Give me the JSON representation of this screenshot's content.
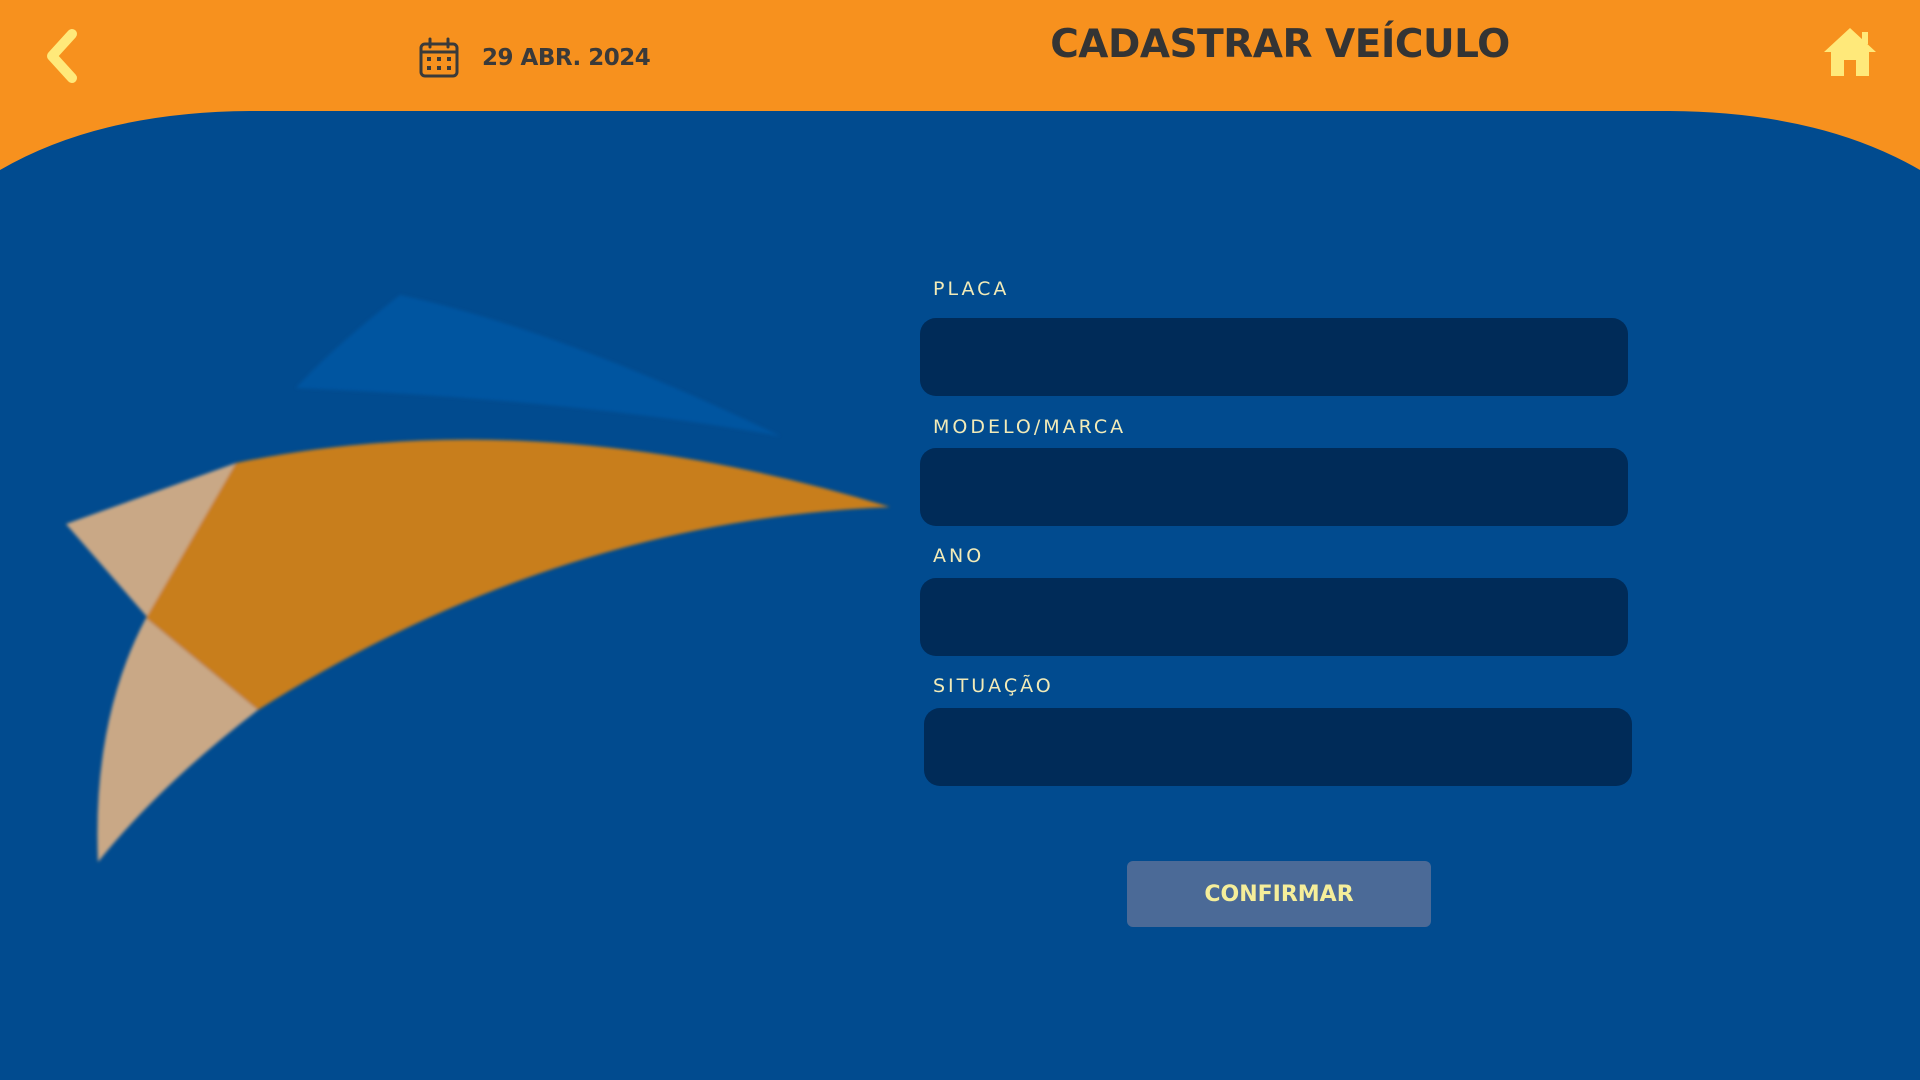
{
  "header": {
    "date": "29 ABR. 2024",
    "title": "CADASTRAR VEÍCULO",
    "icons": {
      "back": "chevron-left-icon",
      "calendar": "calendar-icon",
      "home": "home-icon"
    }
  },
  "form": {
    "fields": [
      {
        "label": "PLACA",
        "value": ""
      },
      {
        "label": "MODELO/MARCA",
        "value": ""
      },
      {
        "label": "ANO",
        "value": ""
      },
      {
        "label": "SITUAÇÃO",
        "value": ""
      }
    ],
    "confirm_label": "CONFIRMAR"
  },
  "colors": {
    "header": "#f7911e",
    "background": "#014b8f",
    "input": "#002b58",
    "button": "#4b6a97",
    "button_text": "#f5ee9a",
    "accent": "#ffe97a"
  }
}
